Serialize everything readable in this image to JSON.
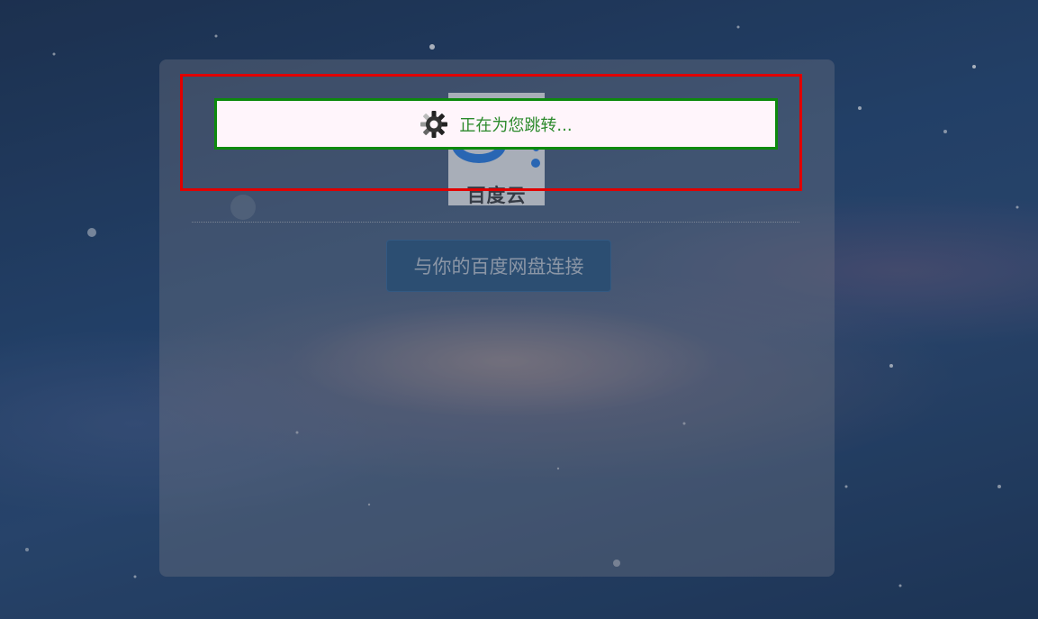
{
  "logo": {
    "text": "百度云",
    "accent_color": "#1f6fd1"
  },
  "connect_button": {
    "label": "与你的百度网盘连接"
  },
  "redirect": {
    "text": "正在为您跳转...",
    "icon": "loading-gear-icon",
    "text_color": "#2c8a2c",
    "border_color": "#0d8a0d"
  },
  "highlight_frame_color": "#e00000"
}
